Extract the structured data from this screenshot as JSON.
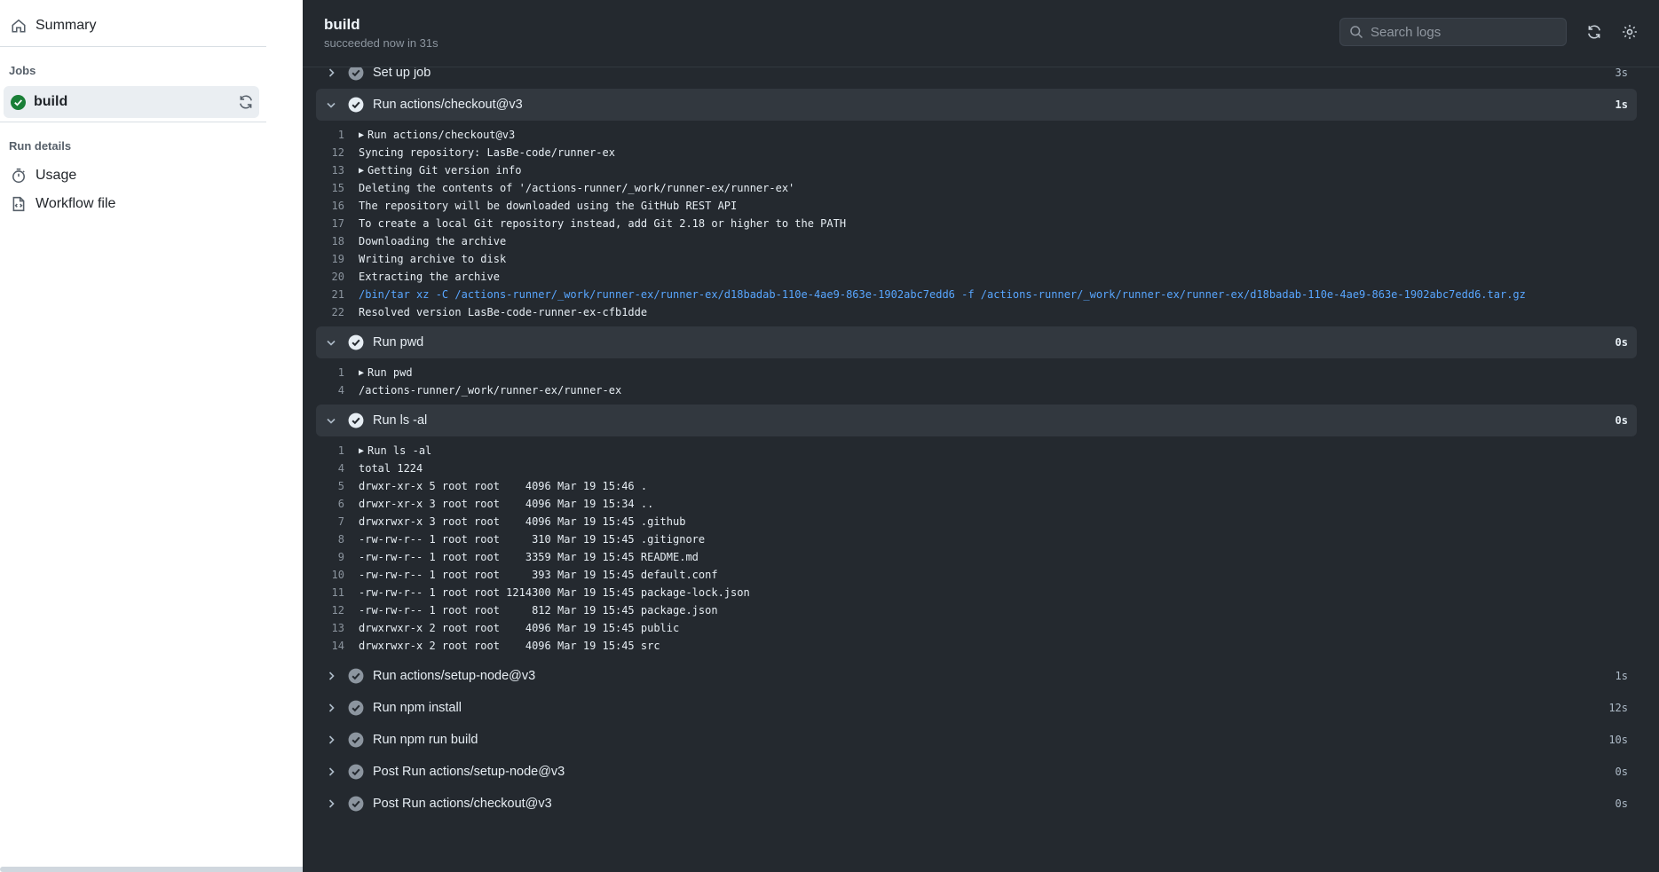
{
  "sidebar": {
    "summary": "Summary",
    "jobs_heading": "Jobs",
    "job": "build",
    "run_details_heading": "Run details",
    "usage": "Usage",
    "workflow_file": "Workflow file"
  },
  "header": {
    "title": "build",
    "subtitle": "succeeded now in 31s",
    "search_placeholder": "Search logs"
  },
  "steps": [
    {
      "name": "Set up job",
      "duration": "3s",
      "expanded": false,
      "lines": []
    },
    {
      "name": "Run actions/checkout@v3",
      "duration": "1s",
      "expanded": true,
      "lines": [
        {
          "n": "1",
          "t": "Run actions/checkout@v3",
          "group": true
        },
        {
          "n": "12",
          "t": "Syncing repository: LasBe-code/runner-ex"
        },
        {
          "n": "13",
          "t": "Getting Git version info",
          "group": true
        },
        {
          "n": "15",
          "t": "Deleting the contents of '/actions-runner/_work/runner-ex/runner-ex'"
        },
        {
          "n": "16",
          "t": "The repository will be downloaded using the GitHub REST API"
        },
        {
          "n": "17",
          "t": "To create a local Git repository instead, add Git 2.18 or higher to the PATH"
        },
        {
          "n": "18",
          "t": "Downloading the archive"
        },
        {
          "n": "19",
          "t": "Writing archive to disk"
        },
        {
          "n": "20",
          "t": "Extracting the archive"
        },
        {
          "n": "21",
          "t": "/bin/tar xz -C /actions-runner/_work/runner-ex/runner-ex/d18badab-110e-4ae9-863e-1902abc7edd6 -f /actions-runner/_work/runner-ex/runner-ex/d18badab-110e-4ae9-863e-1902abc7edd6.tar.gz",
          "cmd": true
        },
        {
          "n": "22",
          "t": "Resolved version LasBe-code-runner-ex-cfb1dde"
        }
      ]
    },
    {
      "name": "Run pwd",
      "duration": "0s",
      "expanded": true,
      "lines": [
        {
          "n": "1",
          "t": "Run pwd",
          "group": true
        },
        {
          "n": "4",
          "t": "/actions-runner/_work/runner-ex/runner-ex"
        }
      ]
    },
    {
      "name": "Run ls -al",
      "duration": "0s",
      "expanded": true,
      "lines": [
        {
          "n": "1",
          "t": "Run ls -al",
          "group": true
        },
        {
          "n": "4",
          "t": "total 1224"
        },
        {
          "n": "5",
          "t": "drwxr-xr-x 5 root root    4096 Mar 19 15:46 ."
        },
        {
          "n": "6",
          "t": "drwxr-xr-x 3 root root    4096 Mar 19 15:34 .."
        },
        {
          "n": "7",
          "t": "drwxrwxr-x 3 root root    4096 Mar 19 15:45 .github"
        },
        {
          "n": "8",
          "t": "-rw-rw-r-- 1 root root     310 Mar 19 15:45 .gitignore"
        },
        {
          "n": "9",
          "t": "-rw-rw-r-- 1 root root    3359 Mar 19 15:45 README.md"
        },
        {
          "n": "10",
          "t": "-rw-rw-r-- 1 root root     393 Mar 19 15:45 default.conf"
        },
        {
          "n": "11",
          "t": "-rw-rw-r-- 1 root root 1214300 Mar 19 15:45 package-lock.json"
        },
        {
          "n": "12",
          "t": "-rw-rw-r-- 1 root root     812 Mar 19 15:45 package.json"
        },
        {
          "n": "13",
          "t": "drwxrwxr-x 2 root root    4096 Mar 19 15:45 public"
        },
        {
          "n": "14",
          "t": "drwxrwxr-x 2 root root    4096 Mar 19 15:45 src"
        }
      ]
    },
    {
      "name": "Run actions/setup-node@v3",
      "duration": "1s",
      "expanded": false,
      "lines": []
    },
    {
      "name": "Run npm install",
      "duration": "12s",
      "expanded": false,
      "lines": []
    },
    {
      "name": "Run npm run build",
      "duration": "10s",
      "expanded": false,
      "lines": []
    },
    {
      "name": "Post Run actions/setup-node@v3",
      "duration": "0s",
      "expanded": false,
      "lines": []
    },
    {
      "name": "Post Run actions/checkout@v3",
      "duration": "0s",
      "expanded": false,
      "lines": []
    }
  ],
  "colors": {
    "success_green": "#1a7f37",
    "log_bg": "#24292f",
    "link_blue": "#58a6ff"
  }
}
